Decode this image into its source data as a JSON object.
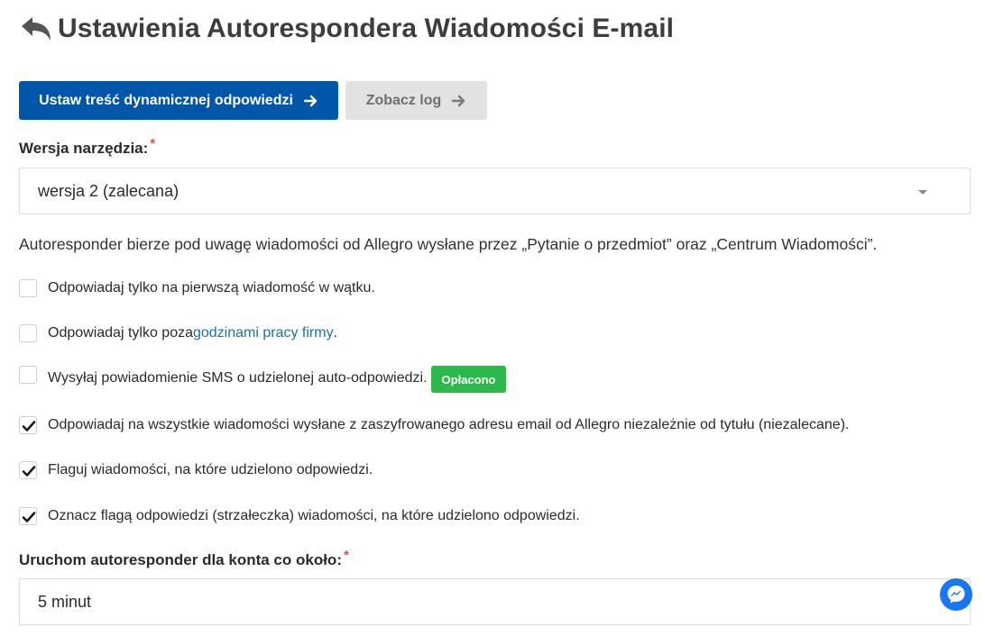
{
  "header": {
    "title": "Ustawienia Autorespondera Wiadomości E-mail",
    "back_icon": "reply-arrow-icon"
  },
  "actions": {
    "primary_label": "Ustaw treść dynamicznej odpowiedzi",
    "secondary_label": "Zobacz log",
    "primary_color": "#0056a8",
    "secondary_color": "#e2e2e2"
  },
  "version_field": {
    "label": "Wersja narzędzia:",
    "required_mark": "*",
    "value": "wersja 2 (zalecana)"
  },
  "info": "Autoresponder bierze pod uwagę wiadomości od Allegro wysłane przez „Pytanie o przedmiot” oraz „Centrum Wiadomości”.",
  "options": [
    {
      "label": "Odpowiadaj tylko na pierwszą wiadomość w wątku.",
      "checked": false
    },
    {
      "label_before": "Odpowiadaj tylko poza ",
      "link": "godzinami pracy firmy",
      "label_after": ".",
      "checked": false
    },
    {
      "label": "Wysyłaj powiadomienie SMS o udzielonej auto-odpowiedzi.",
      "badge": "Opłacono",
      "checked": false
    },
    {
      "label": "Odpowiadaj na wszystkie wiadomości wysłane z zaszyfrowanego adresu email od Allegro niezależnie od tytułu (niezalecane).",
      "checked": true
    },
    {
      "label": "Flaguj wiadomości, na które udzielono odpowiedzi.",
      "checked": true
    },
    {
      "label": "Oznacz flagą odpowiedzi (strzałeczka) wiadomości, na które udzielono odpowiedzi.",
      "checked": true
    }
  ],
  "schedule_field": {
    "label": "Uruchom autoresponder dla konta co około:",
    "required_mark": "*",
    "value": "5 minut"
  },
  "chat_widget": {
    "icon": "messenger-icon",
    "color": "#1877f2"
  },
  "badge_color": "#2db84d"
}
